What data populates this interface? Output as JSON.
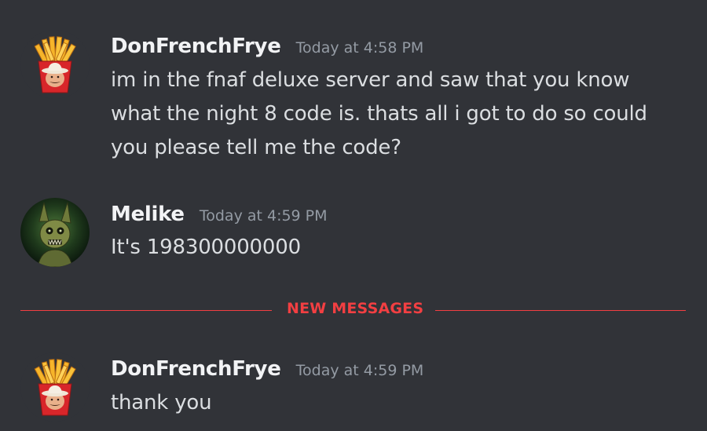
{
  "messages": [
    {
      "username": "DonFrenchFrye",
      "timestamp": "Today at 4:58 PM",
      "avatar": "french-fries-avatar",
      "lines": [
        "im in the fnaf deluxe server and saw that you know",
        "what the night 8 code is. thats all i got to do so could",
        "you please tell me the code?"
      ]
    },
    {
      "username": "Melike",
      "timestamp": "Today at 4:59 PM",
      "avatar": "springtrap-avatar",
      "lines": [
        "It's 198300000000"
      ]
    },
    {
      "username": "DonFrenchFrye",
      "timestamp": "Today at 4:59 PM",
      "avatar": "french-fries-avatar",
      "lines": [
        "thank you"
      ]
    }
  ],
  "divider": {
    "label": "NEW MESSAGES",
    "color": "#f23f42"
  },
  "colors": {
    "background": "#313338",
    "username": "#f2f3f5",
    "text": "#dbdee1",
    "timestamp": "#949ba4"
  }
}
